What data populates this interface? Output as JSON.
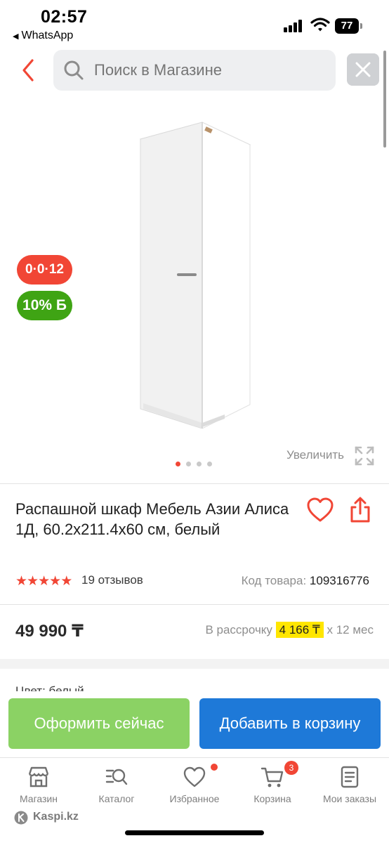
{
  "status_bar": {
    "time": "02:57",
    "back_app": "WhatsApp",
    "battery": "77"
  },
  "search": {
    "placeholder": "Поиск в Магазине"
  },
  "badges": {
    "installment": "0·0·12",
    "bonus": "10% Б"
  },
  "gallery": {
    "zoom_label": "Увеличить",
    "image_count": 4,
    "active_index": 0
  },
  "product": {
    "title": "Распашной шкаф Мебель Азии Алиса 1Д, 60.2x211.4x60 см, белый",
    "rating": 5,
    "reviews": "19 отзывов",
    "code_label": "Код товара:",
    "code_value": "109316776",
    "price": "49 990 ₸",
    "installment_prefix": "В рассрочку",
    "installment_amount": "4 166 ₸",
    "installment_suffix": "x 12 мес",
    "color_label": "Цвет: белый"
  },
  "actions": {
    "buy_now": "Оформить сейчас",
    "add_to_cart": "Добавить в корзину"
  },
  "tabbar": {
    "items": [
      {
        "label": "Магазин",
        "icon": "store-icon"
      },
      {
        "label": "Каталог",
        "icon": "catalog-search-icon"
      },
      {
        "label": "Избранное",
        "icon": "heart-icon"
      },
      {
        "label": "Корзина",
        "icon": "cart-icon",
        "badge": "3"
      },
      {
        "label": "Мои заказы",
        "icon": "orders-icon"
      }
    ]
  },
  "footer": {
    "brand": "Kaspi.kz"
  },
  "colors": {
    "accent_red": "#f14635",
    "bonus_green": "#3fa414",
    "buy_green": "#8bd264",
    "cart_blue": "#1e79d8",
    "installment_yellow": "#ffe600"
  }
}
